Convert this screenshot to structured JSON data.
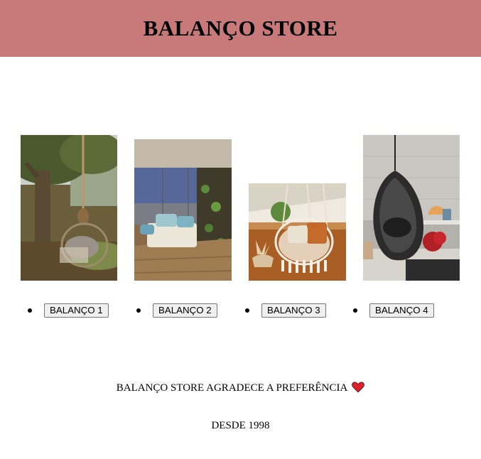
{
  "header": {
    "title": "BALANÇO STORE",
    "background": "#c8797a"
  },
  "products": [
    {
      "image_alt": "garden-swing-chair-photo",
      "button_label": "BALANÇO 1"
    },
    {
      "image_alt": "balcony-swing-bench-photo",
      "button_label": "BALANÇO 2"
    },
    {
      "image_alt": "macrame-hanging-chair-photo",
      "button_label": "BALANÇO 3"
    },
    {
      "image_alt": "black-egg-chair-photo",
      "button_label": "BALANÇO 4"
    }
  ],
  "footer": {
    "thanks_text": "BALANÇO STORE AGRADECE A PREFERÊNCIA",
    "heart_icon": "red-heart-icon",
    "since_text": "DESDE 1998"
  }
}
